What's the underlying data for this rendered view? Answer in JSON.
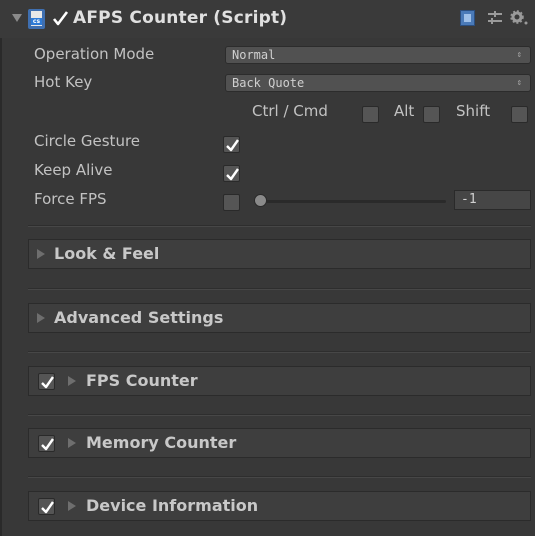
{
  "header": {
    "title": "AFPS Counter (Script)",
    "icons": [
      "fold-arrow-icon",
      "cs-script-icon",
      "checkmark-icon",
      "help-book-icon",
      "presets-icon",
      "gear-icon"
    ]
  },
  "fields": {
    "operation_mode": {
      "label": "Operation Mode",
      "value": "Normal"
    },
    "hot_key": {
      "label": "Hot Key",
      "value": "Back Quote"
    },
    "modifiers": {
      "ctrl_label": "Ctrl / Cmd",
      "alt_label": "Alt",
      "shift_label": "Shift",
      "ctrl": false,
      "alt": false,
      "shift": false
    },
    "circle_gesture": {
      "label": "Circle Gesture",
      "checked": true
    },
    "keep_alive": {
      "label": "Keep Alive",
      "checked": true
    },
    "force_fps": {
      "label": "Force FPS",
      "checked": false,
      "slider_value": -1,
      "value_text": "-1"
    }
  },
  "sections": {
    "look_feel": {
      "title": "Look & Feel"
    },
    "advanced": {
      "title": "Advanced Settings"
    },
    "fps_counter": {
      "title": "FPS Counter",
      "enabled": true
    },
    "memory_counter": {
      "title": "Memory Counter",
      "enabled": true
    },
    "device_info": {
      "title": "Device Information",
      "enabled": true
    }
  },
  "colors": {
    "background": "#383838",
    "panel": "#3e3e3e",
    "text": "#c4c4c4",
    "checkmark": "#ffffff"
  }
}
